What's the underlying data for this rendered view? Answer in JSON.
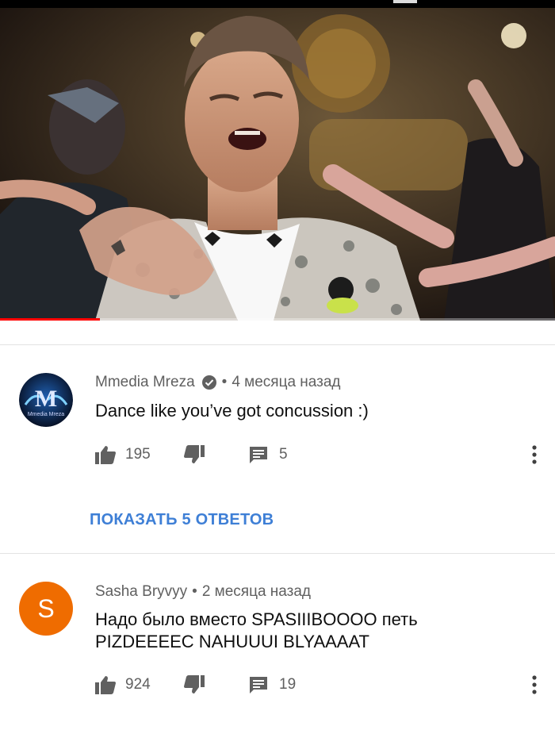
{
  "video": {
    "progress_fraction": 0.18
  },
  "comments": [
    {
      "author": "Mmedia Mreza",
      "verified": true,
      "time": "4 месяца назад",
      "text": "Dance like you’ve got concussion :)",
      "likes": "195",
      "replies": "5",
      "avatar_label": "M",
      "avatar_caption": "Mmedia Mreza"
    },
    {
      "author": "Sasha Bryvyy",
      "verified": false,
      "time": "2 месяца назад",
      "text_lines": [
        "Надо было вместо SPASIIIBOOOO петь",
        "PIZDEEEEC NAHUUUI BLYAAAAT"
      ],
      "likes": "924",
      "replies": "19",
      "avatar_letter": "S"
    }
  ],
  "show_replies_label": "ПОКАЗАТЬ 5 ОТВЕТОВ",
  "icons": {
    "like": "thumb-up-icon",
    "dislike": "thumb-down-icon",
    "reply": "comment-icon",
    "more": "more-vertical-icon",
    "verified": "verified-check-icon"
  },
  "colors": {
    "accent": "#3e7fd6",
    "progress": "#ff0000",
    "avatar_s": "#ef6c00"
  }
}
